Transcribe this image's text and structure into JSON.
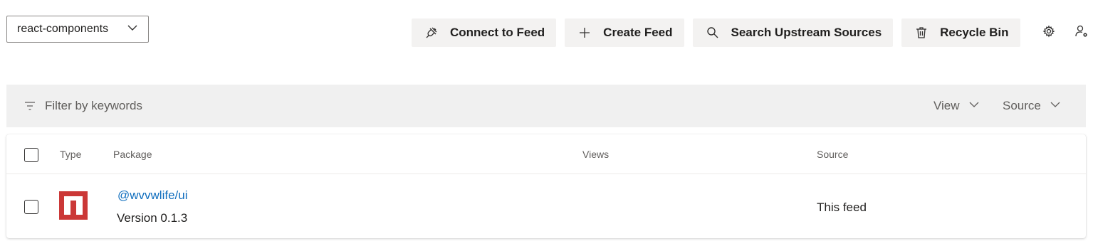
{
  "feed_selector": {
    "value": "react-components"
  },
  "toolbar": {
    "connect_label": "Connect to Feed",
    "create_label": "Create Feed",
    "search_upstream_label": "Search Upstream Sources",
    "recycle_label": "Recycle Bin"
  },
  "filter": {
    "placeholder": "Filter by keywords",
    "view_label": "View",
    "source_label": "Source"
  },
  "table": {
    "columns": {
      "type": "Type",
      "package": "Package",
      "views": "Views",
      "source": "Source"
    },
    "rows": [
      {
        "type_icon": "npm-icon",
        "name": "@wvvwlife/ui",
        "version": "Version 0.1.3",
        "views": "",
        "source": "This feed"
      }
    ]
  },
  "colors": {
    "accent": "#106ebe",
    "npm_red": "#cb3837",
    "button_bg": "#f3f2f1",
    "filter_bg": "#f0f0f0"
  }
}
